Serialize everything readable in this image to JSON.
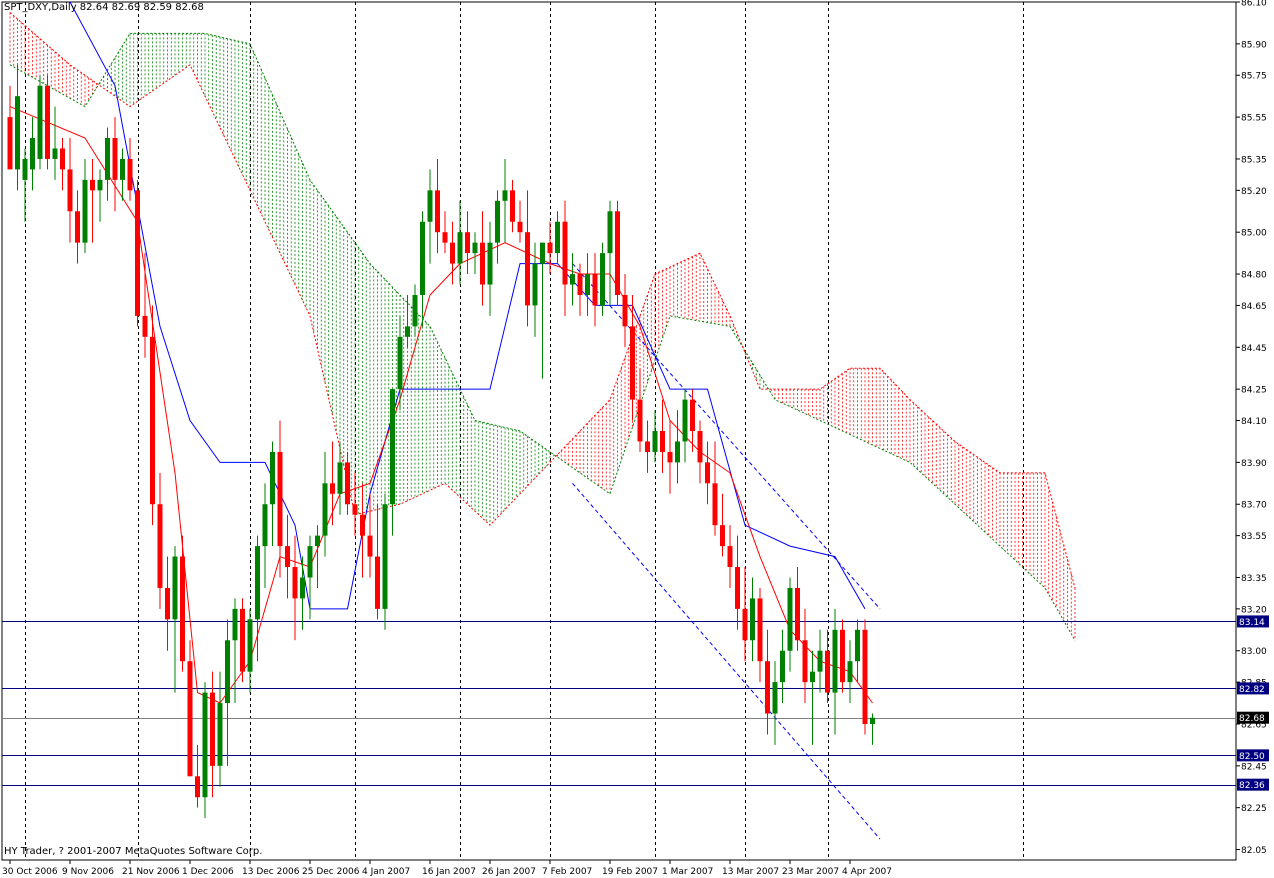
{
  "header": {
    "title": "SPT_DXY,Daily  82.64 82.69 82.59 82.68"
  },
  "footer": {
    "copyright": "HY Trader, ? 2001-2007 MetaQuotes Software Corp."
  },
  "colors": {
    "background": "#ffffff",
    "frame": "#000000",
    "bull": "#008000",
    "bear": "#ff0000",
    "tenkan": "#ff0000",
    "kijun": "#0000ff",
    "kumo_bull": "#008000",
    "kumo_bear": "#ff0000",
    "hline": "#000080",
    "current": "#808080",
    "label_bg": "#000080",
    "label_current_bg": "#000000"
  },
  "chart_data": {
    "type": "candlestick",
    "symbol": "SPT_DXY",
    "timeframe": "Daily",
    "ohlc_readout": {
      "open": 82.64,
      "high": 82.69,
      "low": 82.59,
      "close": 82.68
    },
    "ylim": [
      82.0,
      86.1
    ],
    "y_ticks": [
      86.1,
      85.9,
      85.75,
      85.55,
      85.35,
      85.2,
      85.0,
      84.8,
      84.65,
      84.45,
      84.25,
      84.1,
      83.9,
      83.7,
      83.55,
      83.35,
      83.2,
      83.0,
      82.85,
      82.65,
      82.45,
      82.25,
      82.05
    ],
    "x_labels": [
      {
        "bar": 0,
        "label": "30 Oct 2006"
      },
      {
        "bar": 8,
        "label": "9 Nov 2006"
      },
      {
        "bar": 16,
        "label": "21 Nov 2006"
      },
      {
        "bar": 24,
        "label": "1 Dec 2006"
      },
      {
        "bar": 32,
        "label": "13 Dec 2006"
      },
      {
        "bar": 40,
        "label": "25 Dec 2006"
      },
      {
        "bar": 48,
        "label": "4 Jan 2007"
      },
      {
        "bar": 56,
        "label": "16 Jan 2007"
      },
      {
        "bar": 64,
        "label": "26 Jan 2007"
      },
      {
        "bar": 72,
        "label": "7 Feb 2007"
      },
      {
        "bar": 80,
        "label": "19 Feb 2007"
      },
      {
        "bar": 88,
        "label": "1 Mar 2007"
      },
      {
        "bar": 96,
        "label": "13 Mar 2007"
      },
      {
        "bar": 104,
        "label": "23 Mar 2007"
      },
      {
        "bar": 112,
        "label": "4 Apr 2007"
      }
    ],
    "vlines_at_bars": [
      2,
      17,
      32,
      46,
      60,
      72,
      86,
      98,
      109,
      135
    ],
    "candles": [
      [
        0,
        85.55,
        85.7,
        85.45,
        85.3
      ],
      [
        1,
        85.3,
        85.8,
        85.2,
        85.65
      ],
      [
        2,
        85.25,
        85.4,
        85.05,
        85.35
      ],
      [
        3,
        85.3,
        85.55,
        85.2,
        85.45
      ],
      [
        4,
        85.35,
        85.75,
        85.3,
        85.7
      ],
      [
        5,
        85.7,
        85.75,
        85.3,
        85.35
      ],
      [
        6,
        85.35,
        85.6,
        85.25,
        85.4
      ],
      [
        7,
        85.4,
        85.45,
        85.2,
        85.3
      ],
      [
        8,
        85.3,
        85.45,
        84.95,
        85.1
      ],
      [
        9,
        85.1,
        85.2,
        84.85,
        84.95
      ],
      [
        10,
        84.95,
        85.35,
        84.9,
        85.25
      ],
      [
        11,
        85.25,
        85.35,
        84.95,
        85.2
      ],
      [
        12,
        85.2,
        85.3,
        85.05,
        85.25
      ],
      [
        13,
        85.25,
        85.5,
        85.15,
        85.45
      ],
      [
        14,
        85.45,
        85.55,
        85.1,
        85.25
      ],
      [
        15,
        85.25,
        85.4,
        85.15,
        85.35
      ],
      [
        16,
        85.35,
        85.45,
        85.15,
        85.2
      ],
      [
        17,
        85.2,
        85.25,
        84.55,
        84.6
      ],
      [
        18,
        84.6,
        84.9,
        84.4,
        84.5
      ],
      [
        19,
        84.5,
        84.65,
        83.6,
        83.7
      ],
      [
        20,
        83.7,
        83.85,
        83.2,
        83.3
      ],
      [
        21,
        83.3,
        83.45,
        83.0,
        83.15
      ],
      [
        22,
        83.15,
        83.5,
        82.8,
        83.45
      ],
      [
        23,
        83.45,
        83.55,
        82.9,
        82.95
      ],
      [
        24,
        82.95,
        83.05,
        82.45,
        82.4
      ],
      [
        25,
        82.4,
        82.55,
        82.25,
        82.3
      ],
      [
        26,
        82.3,
        82.85,
        82.2,
        82.8
      ],
      [
        27,
        82.8,
        82.9,
        82.3,
        82.45
      ],
      [
        28,
        82.45,
        82.9,
        82.35,
        82.75
      ],
      [
        29,
        82.75,
        83.15,
        82.45,
        83.05
      ],
      [
        30,
        83.05,
        83.25,
        82.75,
        83.2
      ],
      [
        31,
        83.2,
        83.25,
        82.85,
        82.9
      ],
      [
        32,
        82.9,
        83.2,
        82.8,
        83.15
      ],
      [
        33,
        83.15,
        83.55,
        82.95,
        83.5
      ],
      [
        34,
        83.5,
        83.8,
        83.3,
        83.7
      ],
      [
        35,
        83.7,
        84.0,
        83.5,
        83.95
      ],
      [
        36,
        83.95,
        84.1,
        83.35,
        83.5
      ],
      [
        37,
        83.5,
        83.65,
        83.25,
        83.4
      ],
      [
        38,
        83.4,
        83.55,
        83.05,
        83.25
      ],
      [
        39,
        83.25,
        83.45,
        83.1,
        83.35
      ],
      [
        40,
        83.35,
        83.55,
        83.15,
        83.5
      ],
      [
        41,
        83.5,
        83.6,
        83.3,
        83.55
      ],
      [
        42,
        83.55,
        83.95,
        83.45,
        83.8
      ],
      [
        43,
        83.8,
        84.0,
        83.6,
        83.75
      ],
      [
        44,
        83.75,
        84.0,
        83.65,
        83.9
      ],
      [
        45,
        83.9,
        83.95,
        83.65,
        83.7
      ],
      [
        46,
        83.7,
        83.85,
        83.55,
        83.65
      ],
      [
        47,
        83.65,
        83.8,
        83.35,
        83.55
      ],
      [
        48,
        83.55,
        83.75,
        83.35,
        83.45
      ],
      [
        49,
        83.45,
        83.7,
        83.15,
        83.2
      ],
      [
        50,
        83.2,
        83.75,
        83.1,
        83.7
      ],
      [
        51,
        83.7,
        84.25,
        83.55,
        84.25
      ],
      [
        52,
        84.25,
        84.6,
        84.15,
        84.5
      ],
      [
        53,
        84.5,
        84.7,
        84.45,
        84.55
      ],
      [
        54,
        84.55,
        84.75,
        84.5,
        84.7
      ],
      [
        55,
        84.7,
        85.1,
        84.55,
        85.05
      ],
      [
        56,
        85.05,
        85.3,
        84.85,
        85.2
      ],
      [
        57,
        85.2,
        85.35,
        84.9,
        85.0
      ],
      [
        58,
        85.0,
        85.1,
        84.9,
        84.95
      ],
      [
        59,
        84.95,
        85.05,
        84.75,
        84.85
      ],
      [
        60,
        84.85,
        85.15,
        84.75,
        85.0
      ],
      [
        61,
        85.0,
        85.1,
        84.8,
        84.9
      ],
      [
        62,
        84.9,
        85.0,
        84.8,
        84.95
      ],
      [
        63,
        84.95,
        85.1,
        84.65,
        84.75
      ],
      [
        64,
        84.75,
        85.05,
        84.6,
        84.95
      ],
      [
        65,
        84.95,
        85.2,
        84.85,
        85.15
      ],
      [
        66,
        85.15,
        85.35,
        84.95,
        85.2
      ],
      [
        67,
        85.2,
        85.25,
        85.0,
        85.05
      ],
      [
        68,
        85.05,
        85.15,
        84.95,
        85.0
      ],
      [
        69,
        85.0,
        85.2,
        84.55,
        84.65
      ],
      [
        70,
        84.65,
        84.95,
        84.5,
        84.85
      ],
      [
        71,
        84.85,
        84.95,
        84.3,
        84.95
      ],
      [
        72,
        84.95,
        85.05,
        84.8,
        84.9
      ],
      [
        73,
        84.9,
        85.1,
        84.85,
        85.05
      ],
      [
        74,
        85.05,
        85.15,
        84.6,
        84.75
      ],
      [
        75,
        84.75,
        84.9,
        84.65,
        84.8
      ],
      [
        76,
        84.8,
        84.85,
        84.6,
        84.7
      ],
      [
        77,
        84.7,
        84.9,
        84.6,
        84.8
      ],
      [
        78,
        84.8,
        84.9,
        84.55,
        84.65
      ],
      [
        79,
        84.65,
        84.95,
        84.6,
        84.9
      ],
      [
        80,
        84.9,
        85.15,
        84.65,
        85.1
      ],
      [
        81,
        85.1,
        85.15,
        84.65,
        84.7
      ],
      [
        82,
        84.7,
        84.8,
        84.45,
        84.55
      ],
      [
        83,
        84.55,
        84.7,
        84.1,
        84.2
      ],
      [
        84,
        84.2,
        84.35,
        83.95,
        84.0
      ],
      [
        85,
        84.0,
        84.1,
        83.85,
        83.95
      ],
      [
        86,
        83.95,
        84.15,
        83.9,
        84.05
      ],
      [
        87,
        84.05,
        84.2,
        83.85,
        83.95
      ],
      [
        88,
        83.95,
        84.1,
        83.75,
        83.9
      ],
      [
        89,
        83.9,
        84.15,
        83.8,
        84.0
      ],
      [
        90,
        84.0,
        84.25,
        83.9,
        84.2
      ],
      [
        91,
        84.2,
        84.25,
        83.95,
        84.05
      ],
      [
        92,
        84.05,
        84.1,
        83.8,
        83.9
      ],
      [
        93,
        83.9,
        84.0,
        83.7,
        83.8
      ],
      [
        94,
        83.8,
        84.0,
        83.55,
        83.6
      ],
      [
        95,
        83.6,
        83.75,
        83.45,
        83.5
      ],
      [
        96,
        83.5,
        83.6,
        83.3,
        83.4
      ],
      [
        97,
        83.4,
        83.55,
        83.1,
        83.2
      ],
      [
        98,
        83.2,
        83.4,
        82.95,
        83.05
      ],
      [
        99,
        83.05,
        83.35,
        82.95,
        83.25
      ],
      [
        100,
        83.25,
        83.3,
        82.85,
        82.95
      ],
      [
        101,
        82.95,
        83.1,
        82.6,
        82.7
      ],
      [
        102,
        82.7,
        82.95,
        82.55,
        82.85
      ],
      [
        103,
        82.85,
        83.1,
        82.75,
        83.0
      ],
      [
        104,
        83.0,
        83.35,
        82.9,
        83.3
      ],
      [
        105,
        83.3,
        83.4,
        83.0,
        83.05
      ],
      [
        106,
        83.05,
        83.2,
        82.75,
        82.85
      ],
      [
        107,
        82.85,
        83.0,
        82.55,
        82.9
      ],
      [
        108,
        82.9,
        83.1,
        82.8,
        83.0
      ],
      [
        109,
        83.0,
        83.1,
        82.75,
        82.8
      ],
      [
        110,
        82.8,
        83.2,
        82.6,
        83.1
      ],
      [
        111,
        83.1,
        83.15,
        82.8,
        82.85
      ],
      [
        112,
        82.85,
        83.05,
        82.75,
        82.95
      ],
      [
        113,
        82.95,
        83.15,
        82.85,
        83.1
      ],
      [
        114,
        83.1,
        83.15,
        82.6,
        82.65
      ],
      [
        115,
        82.65,
        82.7,
        82.55,
        82.68
      ]
    ],
    "horizontal_levels": [
      {
        "price": 83.14,
        "label": "83.14",
        "style": "solid"
      },
      {
        "price": 82.82,
        "label": "82.82",
        "style": "solid"
      },
      {
        "price": 82.68,
        "label": "82.68",
        "style": "current"
      },
      {
        "price": 82.5,
        "label": "82.50",
        "style": "solid"
      },
      {
        "price": 82.36,
        "label": "82.36",
        "style": "solid"
      }
    ],
    "indicators": {
      "ichimoku": {
        "tenkan": [
          [
            0,
            85.6
          ],
          [
            10,
            85.45
          ],
          [
            17,
            85.05
          ],
          [
            22,
            83.85
          ],
          [
            25,
            82.8
          ],
          [
            28,
            82.75
          ],
          [
            32,
            82.95
          ],
          [
            36,
            83.45
          ],
          [
            40,
            83.4
          ],
          [
            44,
            83.75
          ],
          [
            48,
            83.8
          ],
          [
            52,
            84.2
          ],
          [
            56,
            84.7
          ],
          [
            60,
            84.85
          ],
          [
            66,
            84.95
          ],
          [
            72,
            84.85
          ],
          [
            76,
            84.8
          ],
          [
            80,
            84.8
          ],
          [
            84,
            84.55
          ],
          [
            88,
            84.1
          ],
          [
            92,
            83.95
          ],
          [
            96,
            83.85
          ],
          [
            100,
            83.45
          ],
          [
            104,
            83.1
          ],
          [
            108,
            82.95
          ],
          [
            112,
            82.9
          ],
          [
            115,
            82.75
          ]
        ],
        "kijun": [
          [
            8,
            86.1
          ],
          [
            14,
            85.7
          ],
          [
            20,
            84.55
          ],
          [
            24,
            84.1
          ],
          [
            28,
            83.9
          ],
          [
            34,
            83.9
          ],
          [
            38,
            83.6
          ],
          [
            40,
            83.2
          ],
          [
            45,
            83.2
          ],
          [
            48,
            83.75
          ],
          [
            52,
            84.25
          ],
          [
            56,
            84.25
          ],
          [
            64,
            84.25
          ],
          [
            68,
            84.85
          ],
          [
            73,
            84.85
          ],
          [
            78,
            84.65
          ],
          [
            83,
            84.65
          ],
          [
            88,
            84.25
          ],
          [
            93,
            84.25
          ],
          [
            98,
            83.6
          ],
          [
            104,
            83.5
          ],
          [
            110,
            83.45
          ],
          [
            114,
            83.2
          ]
        ],
        "senkou_a": [
          [
            0,
            85.8
          ],
          [
            10,
            85.6
          ],
          [
            16,
            85.95
          ],
          [
            26,
            85.95
          ],
          [
            32,
            85.9
          ],
          [
            40,
            85.25
          ],
          [
            48,
            84.85
          ],
          [
            56,
            84.55
          ],
          [
            62,
            84.1
          ],
          [
            68,
            84.05
          ],
          [
            74,
            83.9
          ],
          [
            80,
            83.75
          ],
          [
            88,
            84.6
          ],
          [
            96,
            84.55
          ],
          [
            102,
            84.2
          ],
          [
            108,
            84.1
          ],
          [
            114,
            84.0
          ],
          [
            120,
            83.9
          ],
          [
            126,
            83.7
          ],
          [
            132,
            83.5
          ],
          [
            138,
            83.3
          ],
          [
            142,
            83.05
          ]
        ],
        "senkou_b": [
          [
            0,
            86.05
          ],
          [
            8,
            85.8
          ],
          [
            16,
            85.6
          ],
          [
            24,
            85.8
          ],
          [
            32,
            85.2
          ],
          [
            40,
            84.6
          ],
          [
            46,
            83.65
          ],
          [
            52,
            83.7
          ],
          [
            58,
            83.8
          ],
          [
            64,
            83.6
          ],
          [
            72,
            83.9
          ],
          [
            80,
            84.2
          ],
          [
            86,
            84.8
          ],
          [
            92,
            84.9
          ],
          [
            96,
            84.6
          ],
          [
            100,
            84.25
          ],
          [
            108,
            84.25
          ],
          [
            112,
            84.35
          ],
          [
            116,
            84.35
          ],
          [
            120,
            84.2
          ],
          [
            126,
            84.0
          ],
          [
            132,
            83.85
          ],
          [
            138,
            83.85
          ],
          [
            142,
            83.3
          ]
        ]
      },
      "channel": {
        "upper": [
          [
            75,
            84.85
          ],
          [
            116,
            83.2
          ]
        ],
        "lower": [
          [
            75,
            83.8
          ],
          [
            116,
            82.1
          ]
        ]
      }
    }
  }
}
